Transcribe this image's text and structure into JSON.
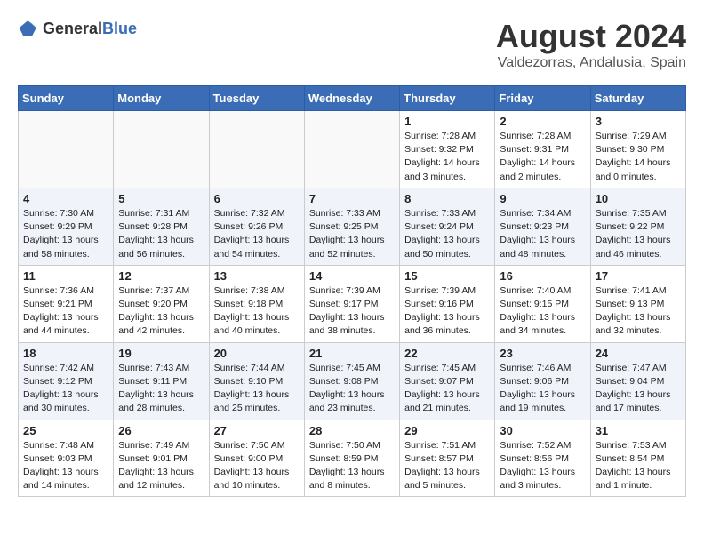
{
  "header": {
    "logo_general": "General",
    "logo_blue": "Blue",
    "month_year": "August 2024",
    "location": "Valdezorras, Andalusia, Spain"
  },
  "weekdays": [
    "Sunday",
    "Monday",
    "Tuesday",
    "Wednesday",
    "Thursday",
    "Friday",
    "Saturday"
  ],
  "weeks": [
    [
      {
        "day": "",
        "info": ""
      },
      {
        "day": "",
        "info": ""
      },
      {
        "day": "",
        "info": ""
      },
      {
        "day": "",
        "info": ""
      },
      {
        "day": "1",
        "info": "Sunrise: 7:28 AM\nSunset: 9:32 PM\nDaylight: 14 hours\nand 3 minutes."
      },
      {
        "day": "2",
        "info": "Sunrise: 7:28 AM\nSunset: 9:31 PM\nDaylight: 14 hours\nand 2 minutes."
      },
      {
        "day": "3",
        "info": "Sunrise: 7:29 AM\nSunset: 9:30 PM\nDaylight: 14 hours\nand 0 minutes."
      }
    ],
    [
      {
        "day": "4",
        "info": "Sunrise: 7:30 AM\nSunset: 9:29 PM\nDaylight: 13 hours\nand 58 minutes."
      },
      {
        "day": "5",
        "info": "Sunrise: 7:31 AM\nSunset: 9:28 PM\nDaylight: 13 hours\nand 56 minutes."
      },
      {
        "day": "6",
        "info": "Sunrise: 7:32 AM\nSunset: 9:26 PM\nDaylight: 13 hours\nand 54 minutes."
      },
      {
        "day": "7",
        "info": "Sunrise: 7:33 AM\nSunset: 9:25 PM\nDaylight: 13 hours\nand 52 minutes."
      },
      {
        "day": "8",
        "info": "Sunrise: 7:33 AM\nSunset: 9:24 PM\nDaylight: 13 hours\nand 50 minutes."
      },
      {
        "day": "9",
        "info": "Sunrise: 7:34 AM\nSunset: 9:23 PM\nDaylight: 13 hours\nand 48 minutes."
      },
      {
        "day": "10",
        "info": "Sunrise: 7:35 AM\nSunset: 9:22 PM\nDaylight: 13 hours\nand 46 minutes."
      }
    ],
    [
      {
        "day": "11",
        "info": "Sunrise: 7:36 AM\nSunset: 9:21 PM\nDaylight: 13 hours\nand 44 minutes."
      },
      {
        "day": "12",
        "info": "Sunrise: 7:37 AM\nSunset: 9:20 PM\nDaylight: 13 hours\nand 42 minutes."
      },
      {
        "day": "13",
        "info": "Sunrise: 7:38 AM\nSunset: 9:18 PM\nDaylight: 13 hours\nand 40 minutes."
      },
      {
        "day": "14",
        "info": "Sunrise: 7:39 AM\nSunset: 9:17 PM\nDaylight: 13 hours\nand 38 minutes."
      },
      {
        "day": "15",
        "info": "Sunrise: 7:39 AM\nSunset: 9:16 PM\nDaylight: 13 hours\nand 36 minutes."
      },
      {
        "day": "16",
        "info": "Sunrise: 7:40 AM\nSunset: 9:15 PM\nDaylight: 13 hours\nand 34 minutes."
      },
      {
        "day": "17",
        "info": "Sunrise: 7:41 AM\nSunset: 9:13 PM\nDaylight: 13 hours\nand 32 minutes."
      }
    ],
    [
      {
        "day": "18",
        "info": "Sunrise: 7:42 AM\nSunset: 9:12 PM\nDaylight: 13 hours\nand 30 minutes."
      },
      {
        "day": "19",
        "info": "Sunrise: 7:43 AM\nSunset: 9:11 PM\nDaylight: 13 hours\nand 28 minutes."
      },
      {
        "day": "20",
        "info": "Sunrise: 7:44 AM\nSunset: 9:10 PM\nDaylight: 13 hours\nand 25 minutes."
      },
      {
        "day": "21",
        "info": "Sunrise: 7:45 AM\nSunset: 9:08 PM\nDaylight: 13 hours\nand 23 minutes."
      },
      {
        "day": "22",
        "info": "Sunrise: 7:45 AM\nSunset: 9:07 PM\nDaylight: 13 hours\nand 21 minutes."
      },
      {
        "day": "23",
        "info": "Sunrise: 7:46 AM\nSunset: 9:06 PM\nDaylight: 13 hours\nand 19 minutes."
      },
      {
        "day": "24",
        "info": "Sunrise: 7:47 AM\nSunset: 9:04 PM\nDaylight: 13 hours\nand 17 minutes."
      }
    ],
    [
      {
        "day": "25",
        "info": "Sunrise: 7:48 AM\nSunset: 9:03 PM\nDaylight: 13 hours\nand 14 minutes."
      },
      {
        "day": "26",
        "info": "Sunrise: 7:49 AM\nSunset: 9:01 PM\nDaylight: 13 hours\nand 12 minutes."
      },
      {
        "day": "27",
        "info": "Sunrise: 7:50 AM\nSunset: 9:00 PM\nDaylight: 13 hours\nand 10 minutes."
      },
      {
        "day": "28",
        "info": "Sunrise: 7:50 AM\nSunset: 8:59 PM\nDaylight: 13 hours\nand 8 minutes."
      },
      {
        "day": "29",
        "info": "Sunrise: 7:51 AM\nSunset: 8:57 PM\nDaylight: 13 hours\nand 5 minutes."
      },
      {
        "day": "30",
        "info": "Sunrise: 7:52 AM\nSunset: 8:56 PM\nDaylight: 13 hours\nand 3 minutes."
      },
      {
        "day": "31",
        "info": "Sunrise: 7:53 AM\nSunset: 8:54 PM\nDaylight: 13 hours\nand 1 minute."
      }
    ]
  ]
}
